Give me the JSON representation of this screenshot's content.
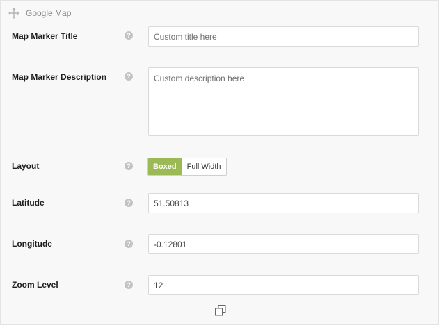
{
  "header": {
    "title": "Google Map"
  },
  "fields": {
    "marker_title": {
      "label": "Map Marker Title",
      "placeholder": "Custom title here",
      "value": ""
    },
    "marker_description": {
      "label": "Map Marker Description",
      "placeholder": "Custom description here",
      "value": ""
    },
    "layout": {
      "label": "Layout",
      "options": [
        "Boxed",
        "Full Width"
      ],
      "selected": "Boxed"
    },
    "latitude": {
      "label": "Latitude",
      "value": "51.50813"
    },
    "longitude": {
      "label": "Longitude",
      "value": "-0.12801"
    },
    "zoom_level": {
      "label": "Zoom Level",
      "value": "12"
    }
  },
  "help_glyph": "?",
  "colors": {
    "accent": "#9bb954",
    "help": "#c3c3c3"
  },
  "icons": {
    "header": "move-icon",
    "help": "help-icon",
    "footer": "clone-icon"
  }
}
